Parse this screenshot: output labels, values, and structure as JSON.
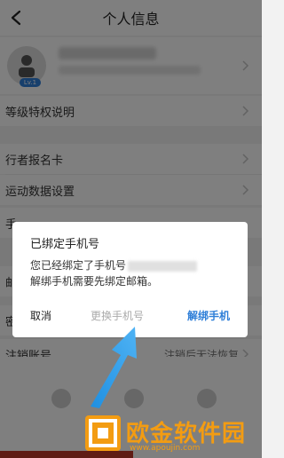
{
  "header": {
    "title": "个人信息",
    "back_icon": "chevron-left-icon"
  },
  "profile": {
    "level_badge": "Lv.1"
  },
  "rows": [
    {
      "label": "等级特权说明",
      "value": ""
    },
    {
      "label": "行者报名卡",
      "value": ""
    },
    {
      "label": "运动数据设置",
      "value": ""
    },
    {
      "label": "手",
      "value": ""
    },
    {
      "label": "邮",
      "value": ""
    },
    {
      "label": "密",
      "value": ""
    },
    {
      "label": "注销账号",
      "value": "注销后无法恢复"
    }
  ],
  "dialog": {
    "title": "已绑定手机号",
    "message_line1": "您已经绑定了手机号",
    "message_line2": "解绑手机需要先绑定邮箱。",
    "cancel_label": "取消",
    "change_label": "更换手机号",
    "unbind_label": "解绑手机",
    "accent_color": "#2f7fd8"
  },
  "watermark": {
    "text": "欧金软件园",
    "url": "www.apoujin.com"
  }
}
